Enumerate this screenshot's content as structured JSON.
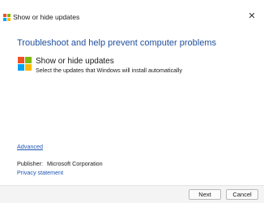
{
  "window": {
    "title": "Show or hide updates",
    "close_glyph": "✕"
  },
  "header": {
    "heading": "Troubleshoot and help prevent computer problems"
  },
  "task": {
    "icon": "windows-logo-icon",
    "title": "Show or hide updates",
    "description": "Select the updates that Windows will install automatically"
  },
  "links": {
    "advanced": "Advanced",
    "privacy": "Privacy statement"
  },
  "publisher": {
    "label": "Publisher:",
    "value": "Microsoft Corporation"
  },
  "buttons": {
    "next": "Next",
    "cancel": "Cancel"
  },
  "colors": {
    "heading": "#1f4e9c",
    "link": "#1f57b5",
    "logo_red": "#f25022",
    "logo_green": "#7fba00",
    "logo_blue": "#00a4ef",
    "logo_yellow": "#ffb900"
  }
}
